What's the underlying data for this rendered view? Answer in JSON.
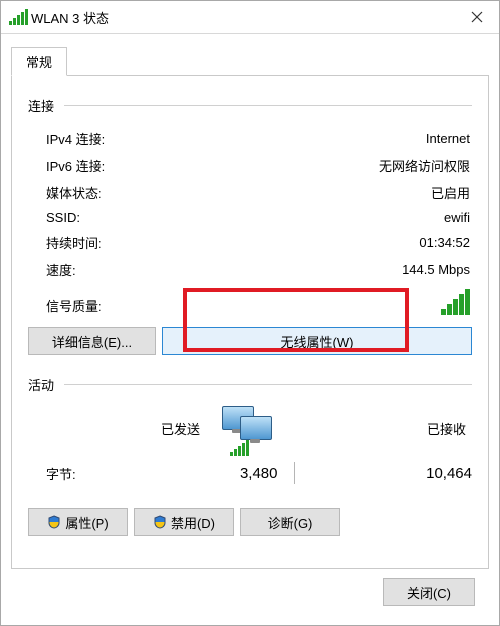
{
  "window": {
    "title": "WLAN 3 状态"
  },
  "tab": {
    "general": "常规"
  },
  "connection": {
    "section_label": "连接",
    "ipv4_label": "IPv4 连接:",
    "ipv4_value": "Internet",
    "ipv6_label": "IPv6 连接:",
    "ipv6_value": "无网络访问权限",
    "media_label": "媒体状态:",
    "media_value": "已启用",
    "ssid_label": "SSID:",
    "ssid_value": "ewifi",
    "duration_label": "持续时间:",
    "duration_value": "01:34:52",
    "speed_label": "速度:",
    "speed_value": "144.5 Mbps",
    "signal_label": "信号质量:"
  },
  "buttons": {
    "details": "详细信息(E)...",
    "wireless_props": "无线属性(W)",
    "properties": "属性(P)",
    "disable": "禁用(D)",
    "diagnose": "诊断(G)",
    "close": "关闭(C)"
  },
  "activity": {
    "section_label": "活动",
    "sent_label": "已发送",
    "recv_label": "已接收",
    "bytes_label": "字节:",
    "bytes_sent": "3,480",
    "bytes_recv": "10,464"
  }
}
